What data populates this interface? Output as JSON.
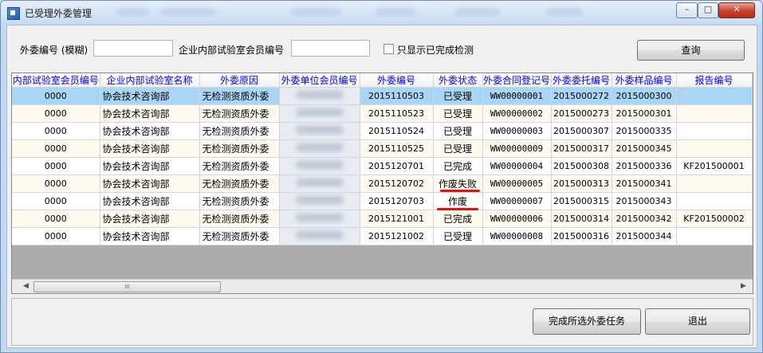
{
  "window": {
    "title": "已受理外委管理",
    "minimize": "–",
    "maximize": "□",
    "close": "✕"
  },
  "filters": {
    "label_number": "外委编号 (模糊)",
    "number_value": "",
    "label_member": "企业内部试验室会员编号",
    "member_value": "",
    "checkbox_label": "只显示已完成检测",
    "checkbox_checked": false,
    "query_button": "查询"
  },
  "table": {
    "columns": [
      "内部试验室会员编号",
      "企业内部试验室名称",
      "外委原因",
      "外委单位会员编号",
      "外委编号",
      "外委状态",
      "外委合同登记号",
      "外委委托编号",
      "外委样品编号",
      "报告编号"
    ],
    "rows": [
      [
        "0000",
        "协会技术咨询部",
        "无检测资质外委",
        "",
        "2015110503",
        "已受理",
        "WW00000001",
        "2015000272",
        "2015000300",
        ""
      ],
      [
        "0000",
        "协会技术咨询部",
        "无检测资质外委",
        "",
        "2015110523",
        "已受理",
        "WW00000002",
        "2015000273",
        "2015000301",
        ""
      ],
      [
        "0000",
        "协会技术咨询部",
        "无检测资质外委",
        "",
        "2015110524",
        "已受理",
        "WW00000003",
        "2015000307",
        "2015000335",
        ""
      ],
      [
        "0000",
        "协会技术咨询部",
        "无检测资质外委",
        "",
        "2015110525",
        "已受理",
        "WW00000009",
        "2015000317",
        "2015000345",
        ""
      ],
      [
        "0000",
        "协会技术咨询部",
        "无检测资质外委",
        "",
        "2015120701",
        "已完成",
        "WW00000004",
        "2015000308",
        "2015000336",
        "KF201500001"
      ],
      [
        "0000",
        "协会技术咨询部",
        "无检测资质外委",
        "",
        "2015120702",
        "作废失败",
        "WW00000005",
        "2015000313",
        "2015000341",
        ""
      ],
      [
        "0000",
        "协会技术咨询部",
        "无检测资质外委",
        "",
        "2015120703",
        "作废",
        "WW00000007",
        "2015000315",
        "2015000343",
        ""
      ],
      [
        "0000",
        "协会技术咨询部",
        "无检测资质外委",
        "",
        "2015121001",
        "已完成",
        "WW00000006",
        "2015000314",
        "2015000342",
        "KF201500002"
      ],
      [
        "0000",
        "协会技术咨询部",
        "无检测资质外委",
        "",
        "2015121002",
        "已受理",
        "WW00000008",
        "2015000316",
        "2015000344",
        ""
      ]
    ],
    "selected_row": 0,
    "scroll_thumb_glyph": "III"
  },
  "actions": {
    "complete_button": "完成所选外委任务",
    "exit_button": "退出"
  },
  "colors": {
    "header_text": "#0000ff",
    "selected_row": "#a9d6f7",
    "annotation": "#e01010"
  }
}
